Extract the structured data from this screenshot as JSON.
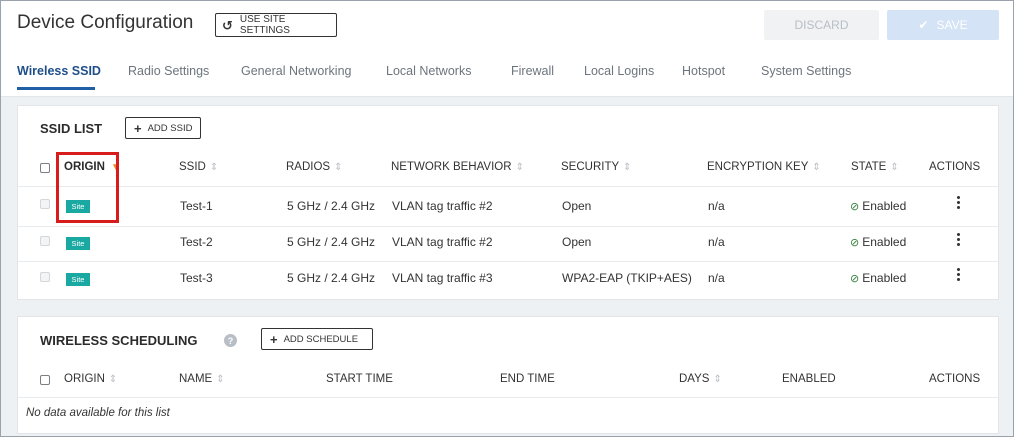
{
  "header": {
    "title": "Device Configuration",
    "use_site_settings_label": "USE SITE SETTINGS",
    "discard_label": "DISCARD",
    "save_label": "SAVE"
  },
  "tabs": [
    {
      "label": "Wireless SSID",
      "active": true
    },
    {
      "label": "Radio Settings"
    },
    {
      "label": "General Networking"
    },
    {
      "label": "Local Networks"
    },
    {
      "label": "Firewall"
    },
    {
      "label": "Local Logins"
    },
    {
      "label": "Hotspot"
    },
    {
      "label": "System Settings"
    }
  ],
  "ssid_list": {
    "title": "SSID LIST",
    "add_label": "ADD SSID",
    "columns": {
      "origin": "ORIGIN",
      "ssid": "SSID",
      "radios": "RADIOS",
      "network_behavior": "NETWORK BEHAVIOR",
      "security": "SECURITY",
      "encryption_key": "ENCRYPTION KEY",
      "state": "STATE",
      "actions": "ACTIONS"
    },
    "rows": [
      {
        "origin": "Site",
        "ssid": "Test-1",
        "radios": "5 GHz / 2.4 GHz",
        "network_behavior": "VLAN tag traffic #2",
        "security": "Open",
        "encryption_key": "n/a",
        "state": "Enabled"
      },
      {
        "origin": "Site",
        "ssid": "Test-2",
        "radios": "5 GHz / 2.4 GHz",
        "network_behavior": "VLAN tag traffic #2",
        "security": "Open",
        "encryption_key": "n/a",
        "state": "Enabled"
      },
      {
        "origin": "Site",
        "ssid": "Test-3",
        "radios": "5 GHz / 2.4 GHz",
        "network_behavior": "VLAN tag traffic #3",
        "security": "WPA2-EAP (TKIP+AES)",
        "encryption_key": "n/a",
        "state": "Enabled"
      }
    ]
  },
  "wireless_scheduling": {
    "title": "WIRELESS SCHEDULING",
    "add_label": "ADD SCHEDULE",
    "columns": {
      "origin": "ORIGIN",
      "name": "NAME",
      "start_time": "START TIME",
      "end_time": "END TIME",
      "days": "DAYS",
      "enabled": "ENABLED",
      "actions": "ACTIONS"
    },
    "empty_text": "No data available for this list"
  },
  "colors": {
    "accent": "#1f5fa5",
    "badge": "#1aa8a2",
    "highlight": "#d81b1b",
    "sort_active": "#f08c28",
    "state_ok": "#2f7d3a"
  },
  "icons": {
    "use_site_settings": "undo-icon",
    "save": "check-icon",
    "add": "plus-icon",
    "help": "help-circle-icon",
    "state": "check-circle-icon",
    "actions": "more-vertical-icon"
  }
}
